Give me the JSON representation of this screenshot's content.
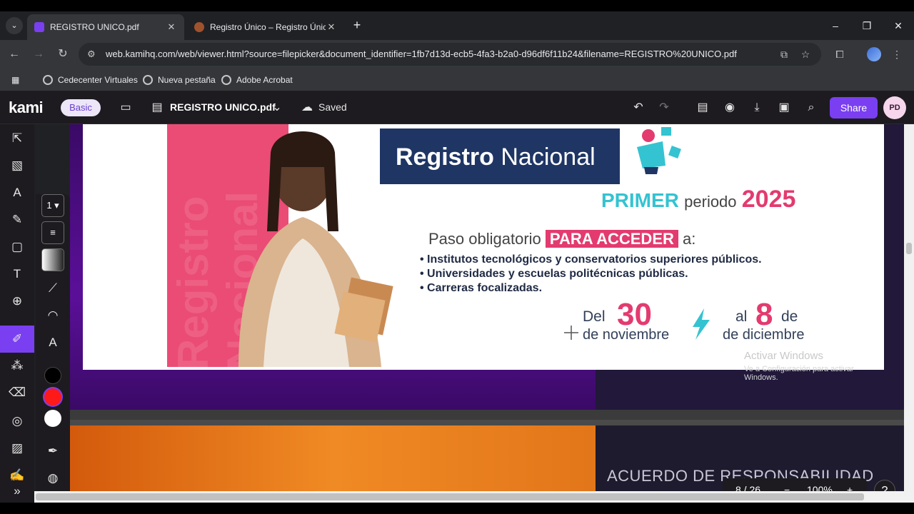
{
  "browser": {
    "tabs": [
      {
        "title": "REGISTRO UNICO.pdf",
        "active": true
      },
      {
        "title": "Registro Único – Registro Único",
        "active": false
      }
    ],
    "url": "web.kamihq.com/web/viewer.html?source=filepicker&document_identifier=1fb7d13d-ecb5-4fa3-b2a0-d96df6f11b24&filename=REGISTRO%20UNICO.pdf",
    "bookmarks": [
      "Cedecenter Virtuales",
      "Nueva pestaña",
      "Adobe Acrobat"
    ]
  },
  "kami": {
    "logo": "kami",
    "plan": "Basic",
    "filename": "REGISTRO UNICO.pdf",
    "save_status": "Saved",
    "share_label": "Share",
    "avatar_initials": "PD",
    "stroke_width": "1",
    "colors": {
      "accent": "#7a3ff0",
      "swatch_black": "#000000",
      "swatch_red": "#ff1a1a",
      "swatch_white": "#ffffff"
    }
  },
  "document": {
    "slide_title_bold": "Registro",
    "slide_title_rest": "Nacional",
    "side_text": "Registro Nacional",
    "period_word1": "PRIMER",
    "period_word2": "periodo",
    "period_year": "2025",
    "paso_text": "Paso obligatorio",
    "paso_highlight": "PARA ACCEDER",
    "paso_end": "a:",
    "bullets": [
      "• Institutos tecnológicos y conservatorios superiores públicos.",
      "• Universidades y escuelas politécnicas públicas.",
      "• Carreras focalizadas."
    ],
    "date_from_label": "Del",
    "date_from_day": "30",
    "date_from_month": "de noviembre",
    "date_to_label": "al",
    "date_to_day": "8",
    "date_to_de": "de",
    "date_to_month": "de diciembre",
    "watermark_title": "Activar Windows",
    "watermark_sub": "Ve a Configuración para activar Windows.",
    "next_slide_title": "ACUERDO DE RESPONSABILIDAD"
  },
  "pager": {
    "page": "8 / 26",
    "zoom": "100%",
    "minus": "−",
    "plus": "+",
    "help": "?"
  }
}
